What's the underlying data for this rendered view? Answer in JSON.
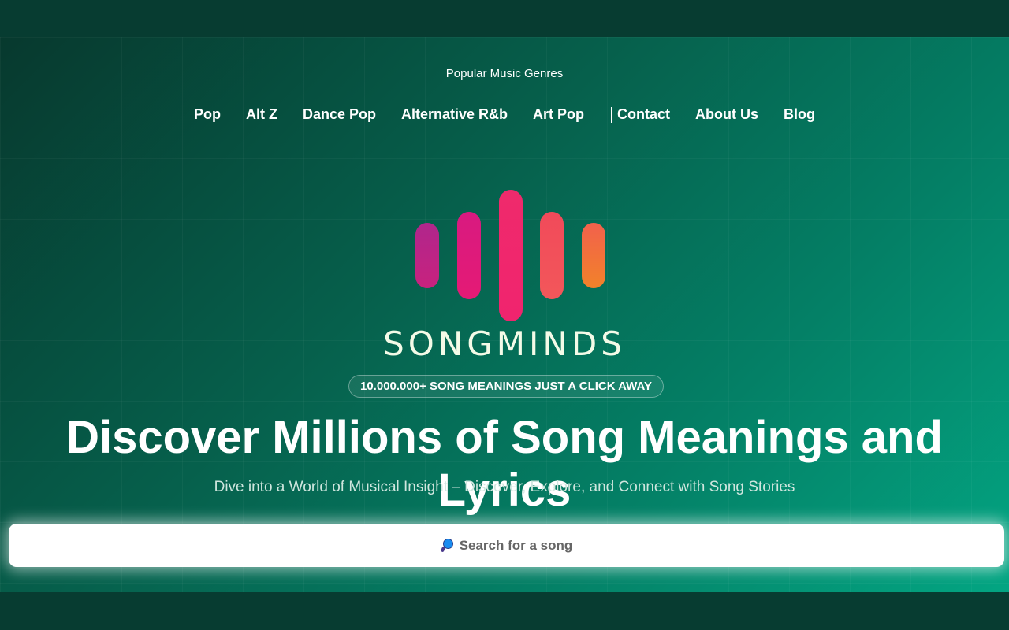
{
  "nav": {
    "title": "Popular Music Genres",
    "genres": [
      "Pop",
      "Alt Z",
      "Dance Pop",
      "Alternative R&b",
      "Art Pop"
    ],
    "links": [
      "Contact",
      "About Us",
      "Blog"
    ]
  },
  "logo": {
    "text": "SONGMINDS",
    "colors": [
      "#b5278a",
      "#e0197a",
      "#f02a6a",
      "#f25456",
      "#f27d2a"
    ]
  },
  "badge": "10.000.000+ SONG MEANINGS JUST A CLICK AWAY",
  "headline": "Discover Millions of Song Meanings and Lyrics",
  "subheadline": "Dive into a World of Musical Insight – Discover, Explore, and Connect with Song Stories",
  "search": {
    "placeholder": "Search for a song"
  }
}
